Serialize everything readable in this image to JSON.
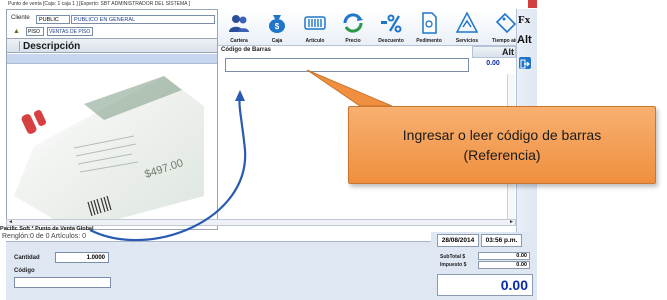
{
  "window": {
    "title": "Punto de venta  [Caja: 1 caja 1 ]   [Experto: SBT  ADMINISTRADOR DEL SISTEMA ]"
  },
  "customer": {
    "label": "Cliente",
    "code": "PUBLIC",
    "name": "PUBLICO EN GENERAL",
    "floor_code": "PISO",
    "floor_name": "VENTAS DE PISO"
  },
  "table": {
    "description_header": "Descripción"
  },
  "toolbar": {
    "items": [
      {
        "label": "Cartera",
        "icon": "users-icon"
      },
      {
        "label": "Caja",
        "icon": "money-bag-icon"
      },
      {
        "label": "Artículo",
        "icon": "barcode-icon"
      },
      {
        "label": "Precio",
        "icon": "refresh-price-icon"
      },
      {
        "label": "Descuento",
        "icon": "percent-icon"
      },
      {
        "label": "Pedimento",
        "icon": "document-icon"
      },
      {
        "label": "Servicios",
        "icon": "services-icon"
      },
      {
        "label": "Tiempo aire",
        "icon": "tag-icon"
      }
    ]
  },
  "barcode": {
    "label": "Código de Barras",
    "value": ""
  },
  "alt_column": {
    "header": "Alt",
    "value": "0.00"
  },
  "side_panel": {
    "fx_label": "Fx",
    "alt_label": "Alt"
  },
  "footer": {
    "company": "Pacific Soft * Punto de Venta Global",
    "counts": "Renglón:0 de 0   Artículos: 0"
  },
  "entry": {
    "quantity_label": "Cantidad",
    "quantity_value": "1.0000",
    "code_label": "Código",
    "code_value": ""
  },
  "totals": {
    "date": "28/08/2014",
    "time": "03:56 p.m.",
    "subtotal_label": "SubTotal $",
    "subtotal_value": "0.00",
    "tax_label": "Impuesto $",
    "tax_value": "0.00",
    "total": "0.00"
  },
  "callout": {
    "line1": "Ingresar o leer código de barras",
    "line2": "(Referencia)"
  },
  "colors": {
    "accent": "#0a2ca8",
    "callout": "#ef8f3f",
    "panel": "#dfe7f3"
  }
}
